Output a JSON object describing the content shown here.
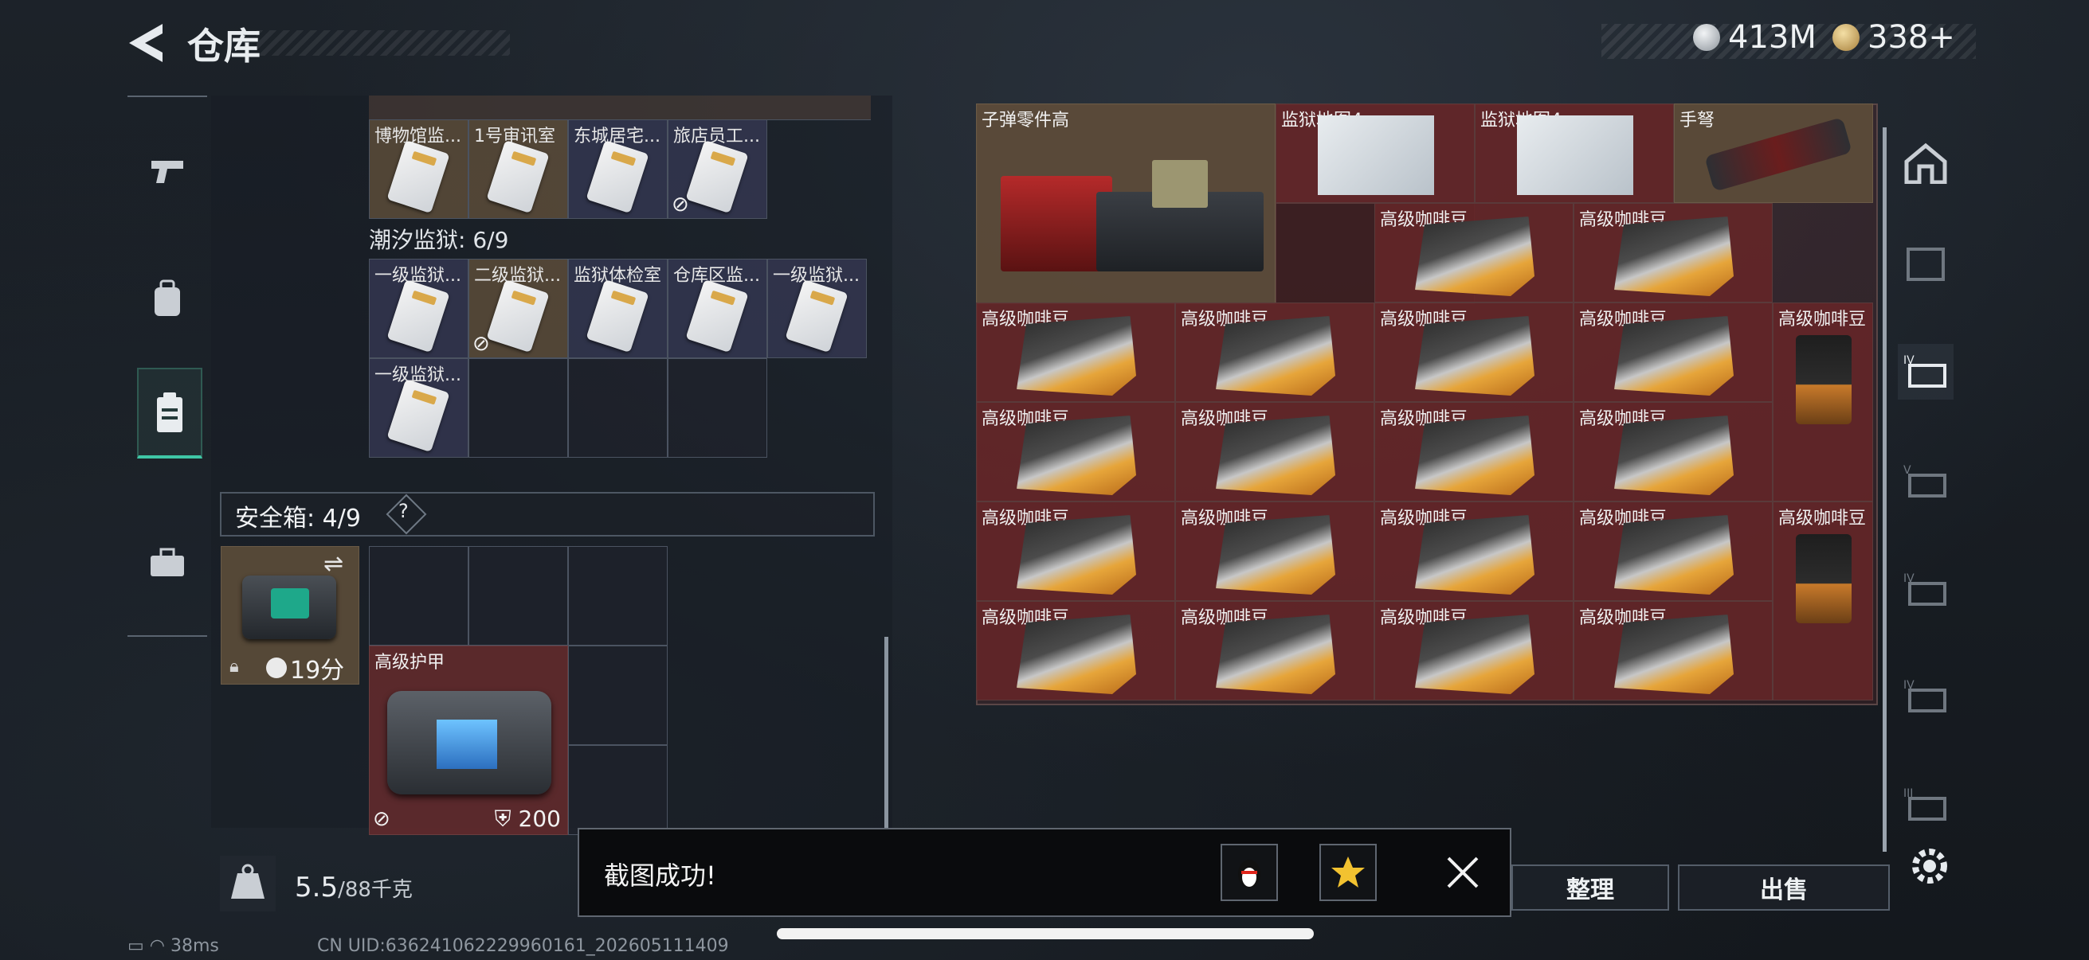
{
  "header": {
    "title": "仓库"
  },
  "currency": [
    {
      "value": "413M",
      "icon": "silver-coin-icon",
      "color": "#c9ced3"
    },
    {
      "value": "338+",
      "icon": "gold-triangle-coin-icon",
      "color": "#d9b46a"
    }
  ],
  "left_rail": [
    "pistol-icon",
    "backpack-icon",
    "clipboard-icon",
    "toolbox-icon"
  ],
  "left_panel": {
    "top_row": [
      {
        "label": "博物馆监..."
      },
      {
        "label": "1号审讯室"
      },
      {
        "label": "东城居宅..."
      },
      {
        "label": "旅店员工..."
      }
    ],
    "prison_title": "潮汐监狱: 6/9",
    "prison_items": [
      {
        "label": "一级监狱..."
      },
      {
        "label": "二级监狱..."
      },
      {
        "label": "监狱体检室"
      },
      {
        "label": "仓库区监..."
      },
      {
        "label": "一级监狱..."
      },
      {
        "label": "一级监狱..."
      }
    ],
    "safe_title": "安全箱: 4/9",
    "safe_help": "?",
    "safe_timer": "19分",
    "armor_label": "高级护甲",
    "armor_durability": "200"
  },
  "right_grid": {
    "top_items": [
      {
        "label": "子弹零件高"
      },
      {
        "label": "监狱地图4"
      },
      {
        "label": "监狱地图4"
      },
      {
        "label": "手弩"
      }
    ],
    "coffee_label": "高级咖啡豆"
  },
  "weight": {
    "current": "5.5",
    "max": "/88千克"
  },
  "toast": {
    "message": "截图成功!"
  },
  "buttons": {
    "sort": "整理",
    "sell": "出售"
  },
  "status": {
    "latency": "38ms",
    "uid": "CN UID:63624106222996016​1_202605111409"
  }
}
